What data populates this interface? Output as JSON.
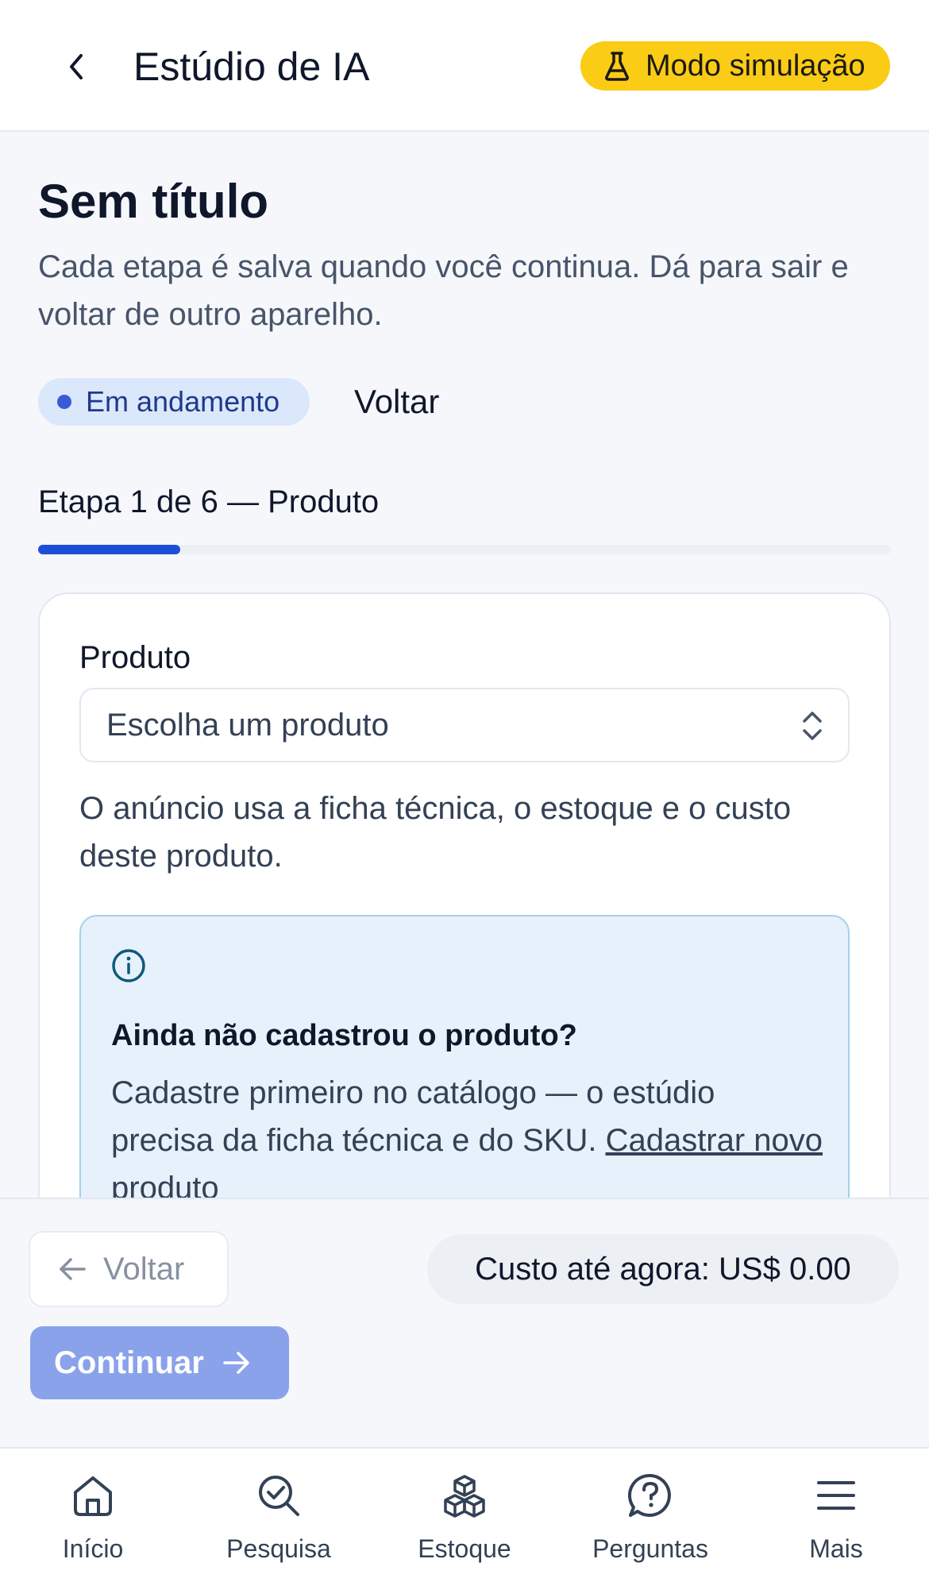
{
  "header": {
    "back_icon": "chevron-left-icon",
    "title": "Estúdio de IA",
    "sim_badge": {
      "icon": "flask-icon",
      "label": "Modo simulação",
      "color": "#facc15"
    }
  },
  "page": {
    "title": "Sem título",
    "subtitle": "Cada etapa é salva quando você continua. Dá para sair e voltar de outro aparelho.",
    "status": "Em andamento",
    "back_link": "Voltar",
    "step_label": "Etapa 1 de 6 — Produto",
    "progress": {
      "current": 1,
      "total": 6
    }
  },
  "card": {
    "field_label": "Produto",
    "select_placeholder": "Escolha um produto",
    "help_text": "O anúncio usa a ficha técnica, o estoque e o custo deste produto.",
    "info": {
      "icon": "info-icon",
      "title": "Ainda não cadastrou o produto?",
      "body": "Cadastre primeiro no catálogo — o estúdio precisa da ficha técnica e do SKU. ",
      "link": "Cadastrar novo produto"
    }
  },
  "actions": {
    "back_label": "Voltar",
    "cost_label": "Custo até agora: US$ 0.00",
    "continue_label": "Continuar",
    "accent": "#1d4ed8"
  },
  "nav": [
    {
      "label": "Início",
      "icon": "home-icon"
    },
    {
      "label": "Pesquisa",
      "icon": "search-check-icon"
    },
    {
      "label": "Estoque",
      "icon": "boxes-icon"
    },
    {
      "label": "Perguntas",
      "icon": "question-bubble-icon"
    },
    {
      "label": "Mais",
      "icon": "menu-icon"
    }
  ]
}
